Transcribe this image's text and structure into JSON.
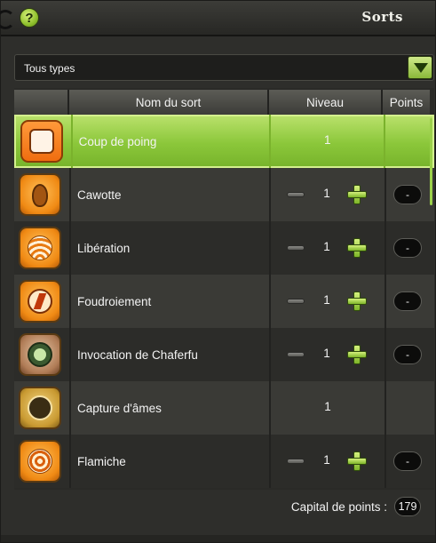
{
  "window": {
    "title": "Sorts"
  },
  "help_icon": "question-mark-icon",
  "filter": {
    "selected": "Tous types",
    "icon": "triangle-down-icon"
  },
  "table": {
    "headers": {
      "name": "Nom du sort",
      "level": "Niveau",
      "points": "Points"
    },
    "rows": [
      {
        "name": "Coup de poing",
        "level": "1",
        "points": "",
        "editable": false,
        "selected": true,
        "icon": "fist-icon"
      },
      {
        "name": "Cawotte",
        "level": "1",
        "points": "-",
        "editable": true,
        "selected": false,
        "icon": "carrot-icon"
      },
      {
        "name": "Libération",
        "level": "1",
        "points": "-",
        "editable": true,
        "selected": false,
        "icon": "waves-icon"
      },
      {
        "name": "Foudroiement",
        "level": "1",
        "points": "-",
        "editable": true,
        "selected": false,
        "icon": "lightning-icon"
      },
      {
        "name": "Invocation de Chaferfu",
        "level": "1",
        "points": "-",
        "editable": true,
        "selected": false,
        "icon": "skull-icon"
      },
      {
        "name": "Capture d'âmes",
        "level": "1",
        "points": "",
        "editable": false,
        "selected": false,
        "icon": "soul-capture-icon"
      },
      {
        "name": "Flamiche",
        "level": "1",
        "points": "-",
        "editable": true,
        "selected": false,
        "icon": "spiral-flame-icon"
      }
    ]
  },
  "footer": {
    "capital_label": "Capital de points :",
    "capital_value": "179"
  },
  "colors": {
    "accent_green": "#8bc73a",
    "background": "#2e2e2b"
  }
}
